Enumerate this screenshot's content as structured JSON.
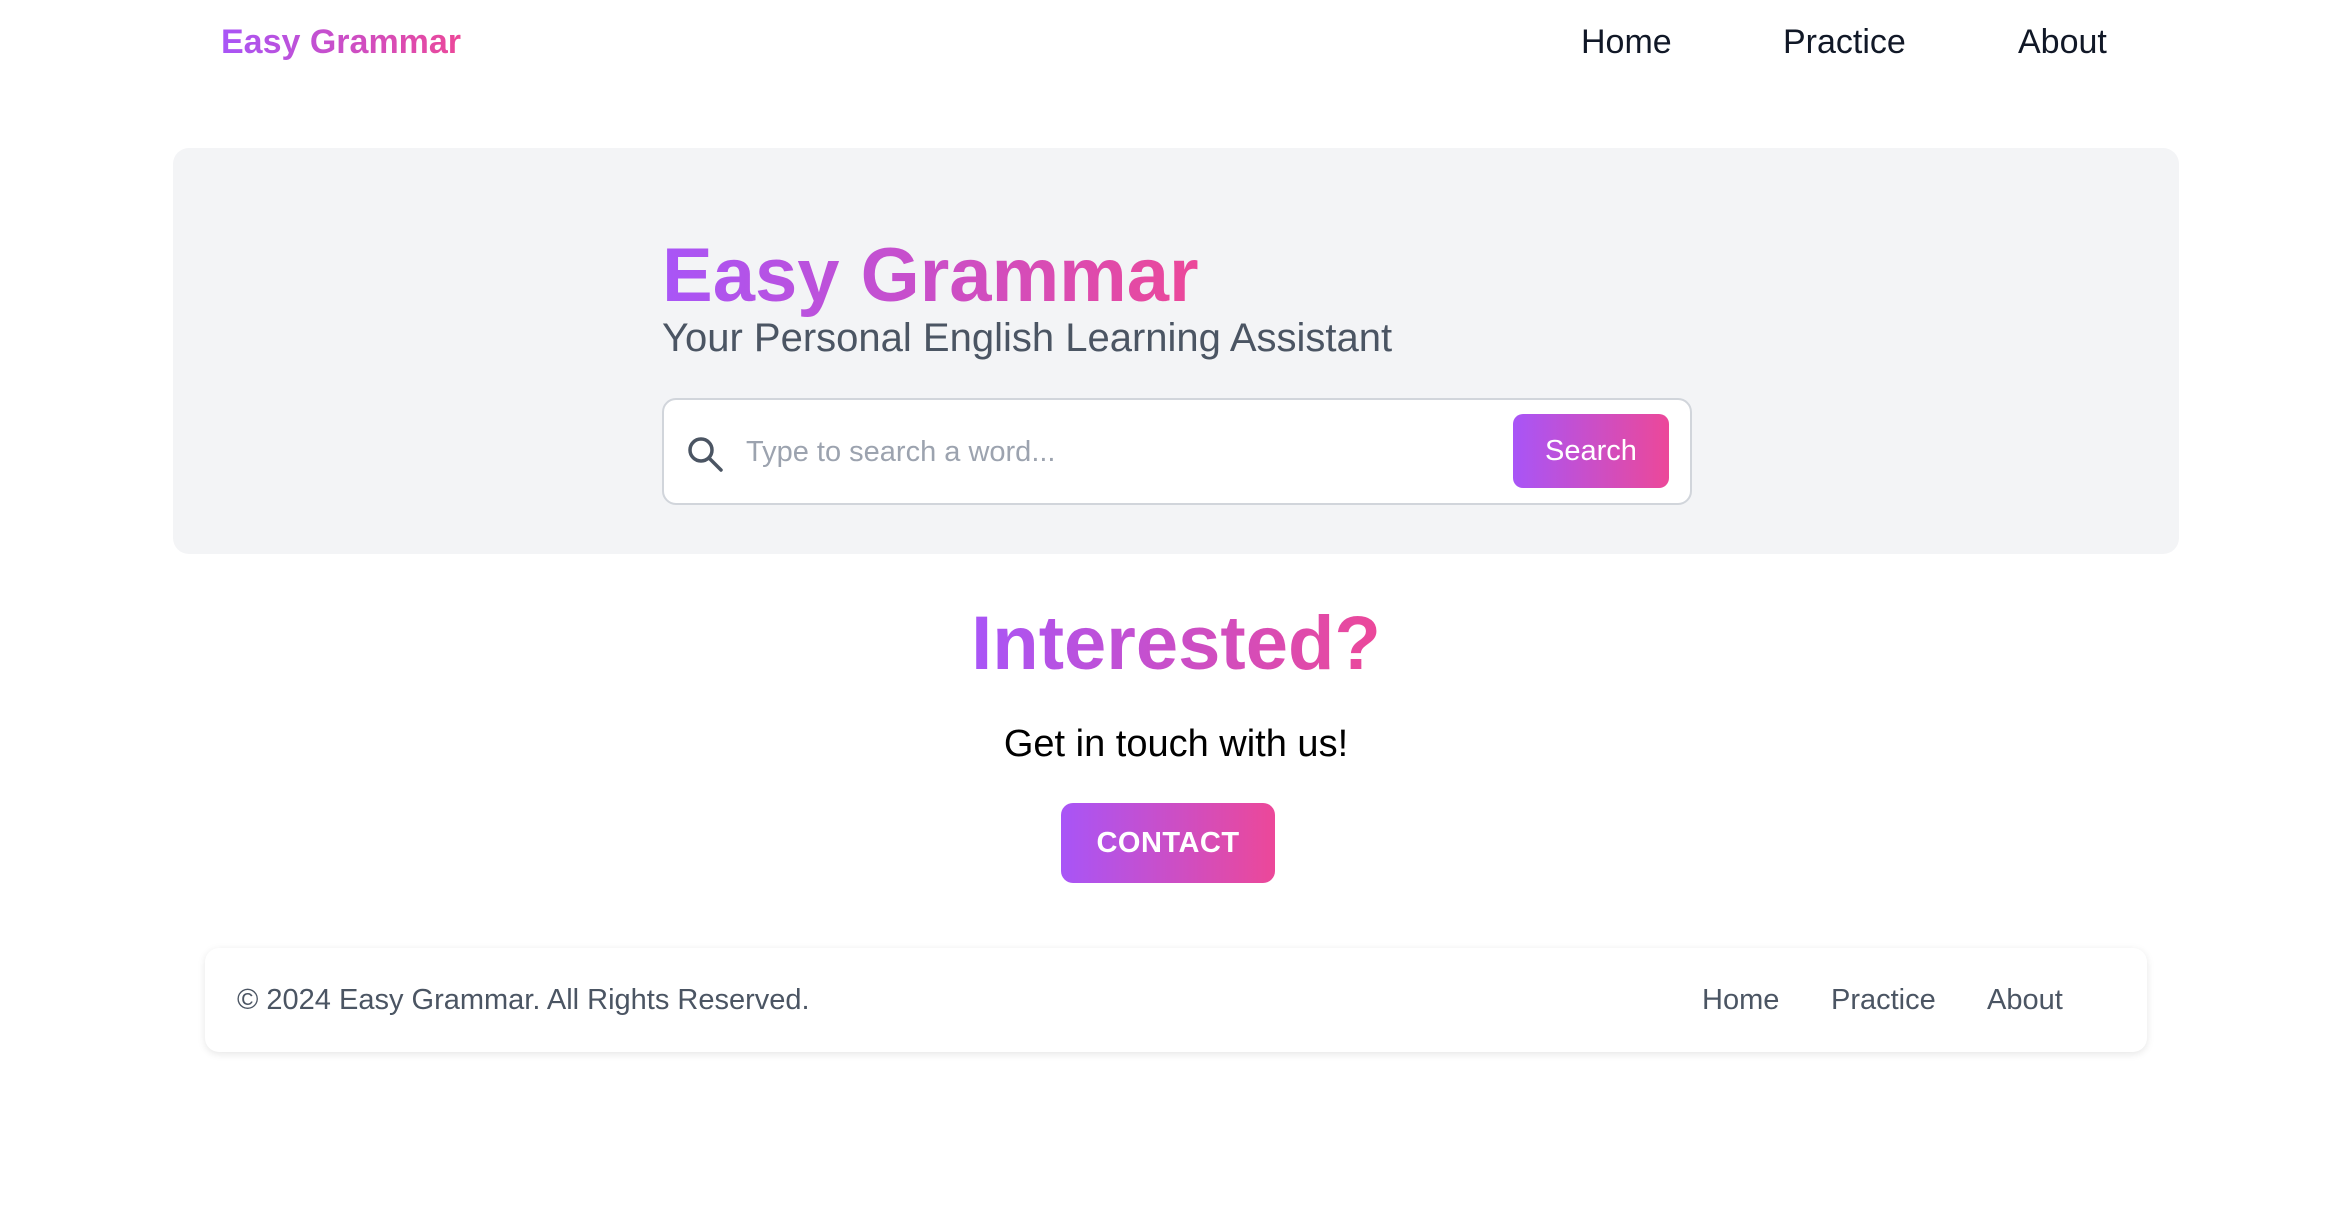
{
  "header": {
    "brand": "Easy Grammar",
    "nav": {
      "home": "Home",
      "practice": "Practice",
      "about": "About"
    }
  },
  "hero": {
    "title": "Easy Grammar",
    "subtitle": "Your Personal English Learning Assistant",
    "search": {
      "placeholder": "Type to search a word...",
      "value": "",
      "button_label": "Search",
      "icon": "search-icon"
    }
  },
  "cta": {
    "title": "Interested?",
    "text": "Get in touch with us!",
    "button_label": "CONTACT"
  },
  "footer": {
    "copyright": "© 2024 Easy Grammar. All Rights Reserved.",
    "links": {
      "home": "Home",
      "practice": "Practice",
      "about": "About"
    }
  },
  "colors": {
    "gradient_start": "#a855f7",
    "gradient_end": "#ec4899",
    "hero_background": "#f3f4f6",
    "nav_text": "#111827",
    "muted_text": "#4b5563"
  }
}
